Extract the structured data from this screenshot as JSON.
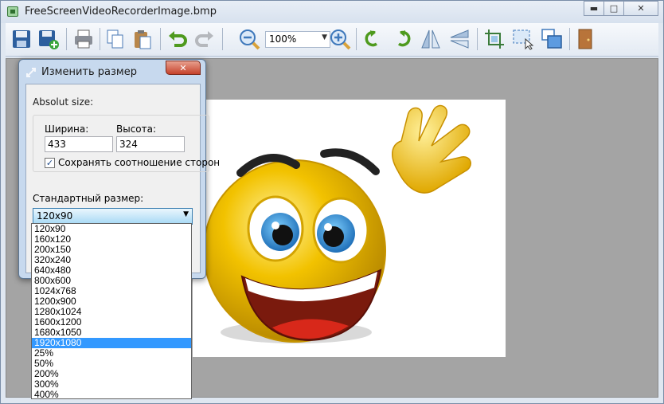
{
  "window": {
    "title": "FreeScreenVideoRecorderImage.bmp",
    "caption_buttons": {
      "minimize": "▬",
      "maximize": "□",
      "close": "✕"
    }
  },
  "toolbar": {
    "zoom_value": "100%",
    "icons": [
      "save-icon",
      "save-as-icon",
      "print-icon",
      "copy-icon",
      "paste-icon",
      "undo-icon",
      "redo-icon",
      "zoom-out-icon",
      "zoom-in-icon",
      "rotate-left-icon",
      "rotate-right-icon",
      "flip-horizontal-icon",
      "flip-vertical-icon",
      "crop-icon",
      "select-icon",
      "resize-icon",
      "exit-icon"
    ]
  },
  "dialog": {
    "title": "Изменить размер",
    "absolut_label": "Absolut size:",
    "width_label": "Ширина:",
    "height_label": "Высота:",
    "width_value": "433",
    "height_value": "324",
    "keep_ratio_label": "Сохранять соотношение сторон",
    "keep_ratio_checked": "✓",
    "standard_size_label": "Стандартный размер:",
    "standard_size_value": "120x90",
    "close_label": "✕"
  },
  "dropdown": {
    "items": [
      "120x90",
      "160x120",
      "200x150",
      "320x240",
      "640x480",
      "800x600",
      "1024x768",
      "1200x900",
      "1280x1024",
      "1600x1200",
      "1680x1050",
      "1920x1080",
      "25%",
      "50%",
      "200%",
      "300%",
      "400%"
    ],
    "highlighted": "1920x1080"
  },
  "colors": {
    "highlight": "#3399ff",
    "smiley_yellow": "#f2c200"
  }
}
